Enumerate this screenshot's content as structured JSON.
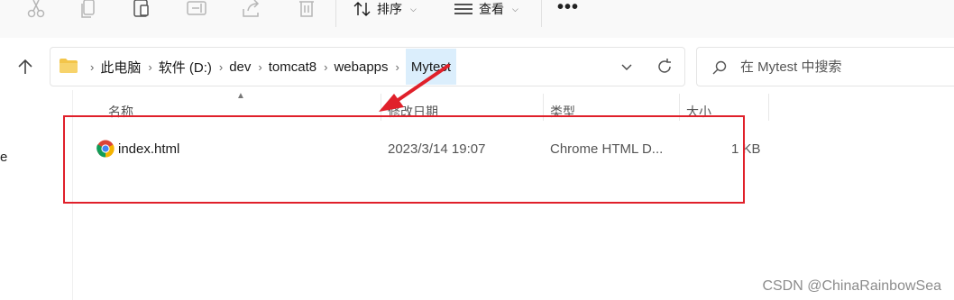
{
  "toolbar": {
    "icons": [
      "cut-icon",
      "copy-icon",
      "paste-icon",
      "rename-icon",
      "share-icon",
      "delete-icon"
    ],
    "sort_label": "排序",
    "view_label": "查看",
    "more_label": "•••"
  },
  "address": {
    "crumbs": [
      "此电脑",
      "软件 (D:)",
      "dev",
      "tomcat8",
      "webapps"
    ],
    "current": "Mytest",
    "separator": "›"
  },
  "search": {
    "placeholder": "在 Mytest 中搜索"
  },
  "nav_edge_text": "e",
  "columns": {
    "name": "名称",
    "date": "修改日期",
    "type": "类型",
    "size": "大小"
  },
  "files": [
    {
      "name": "index.html",
      "date": "2023/3/14 19:07",
      "type": "Chrome HTML D...",
      "size": "1 KB"
    }
  ],
  "annotation": {
    "color": "#e0202a"
  },
  "watermark": "CSDN @ChinaRainbowSea"
}
